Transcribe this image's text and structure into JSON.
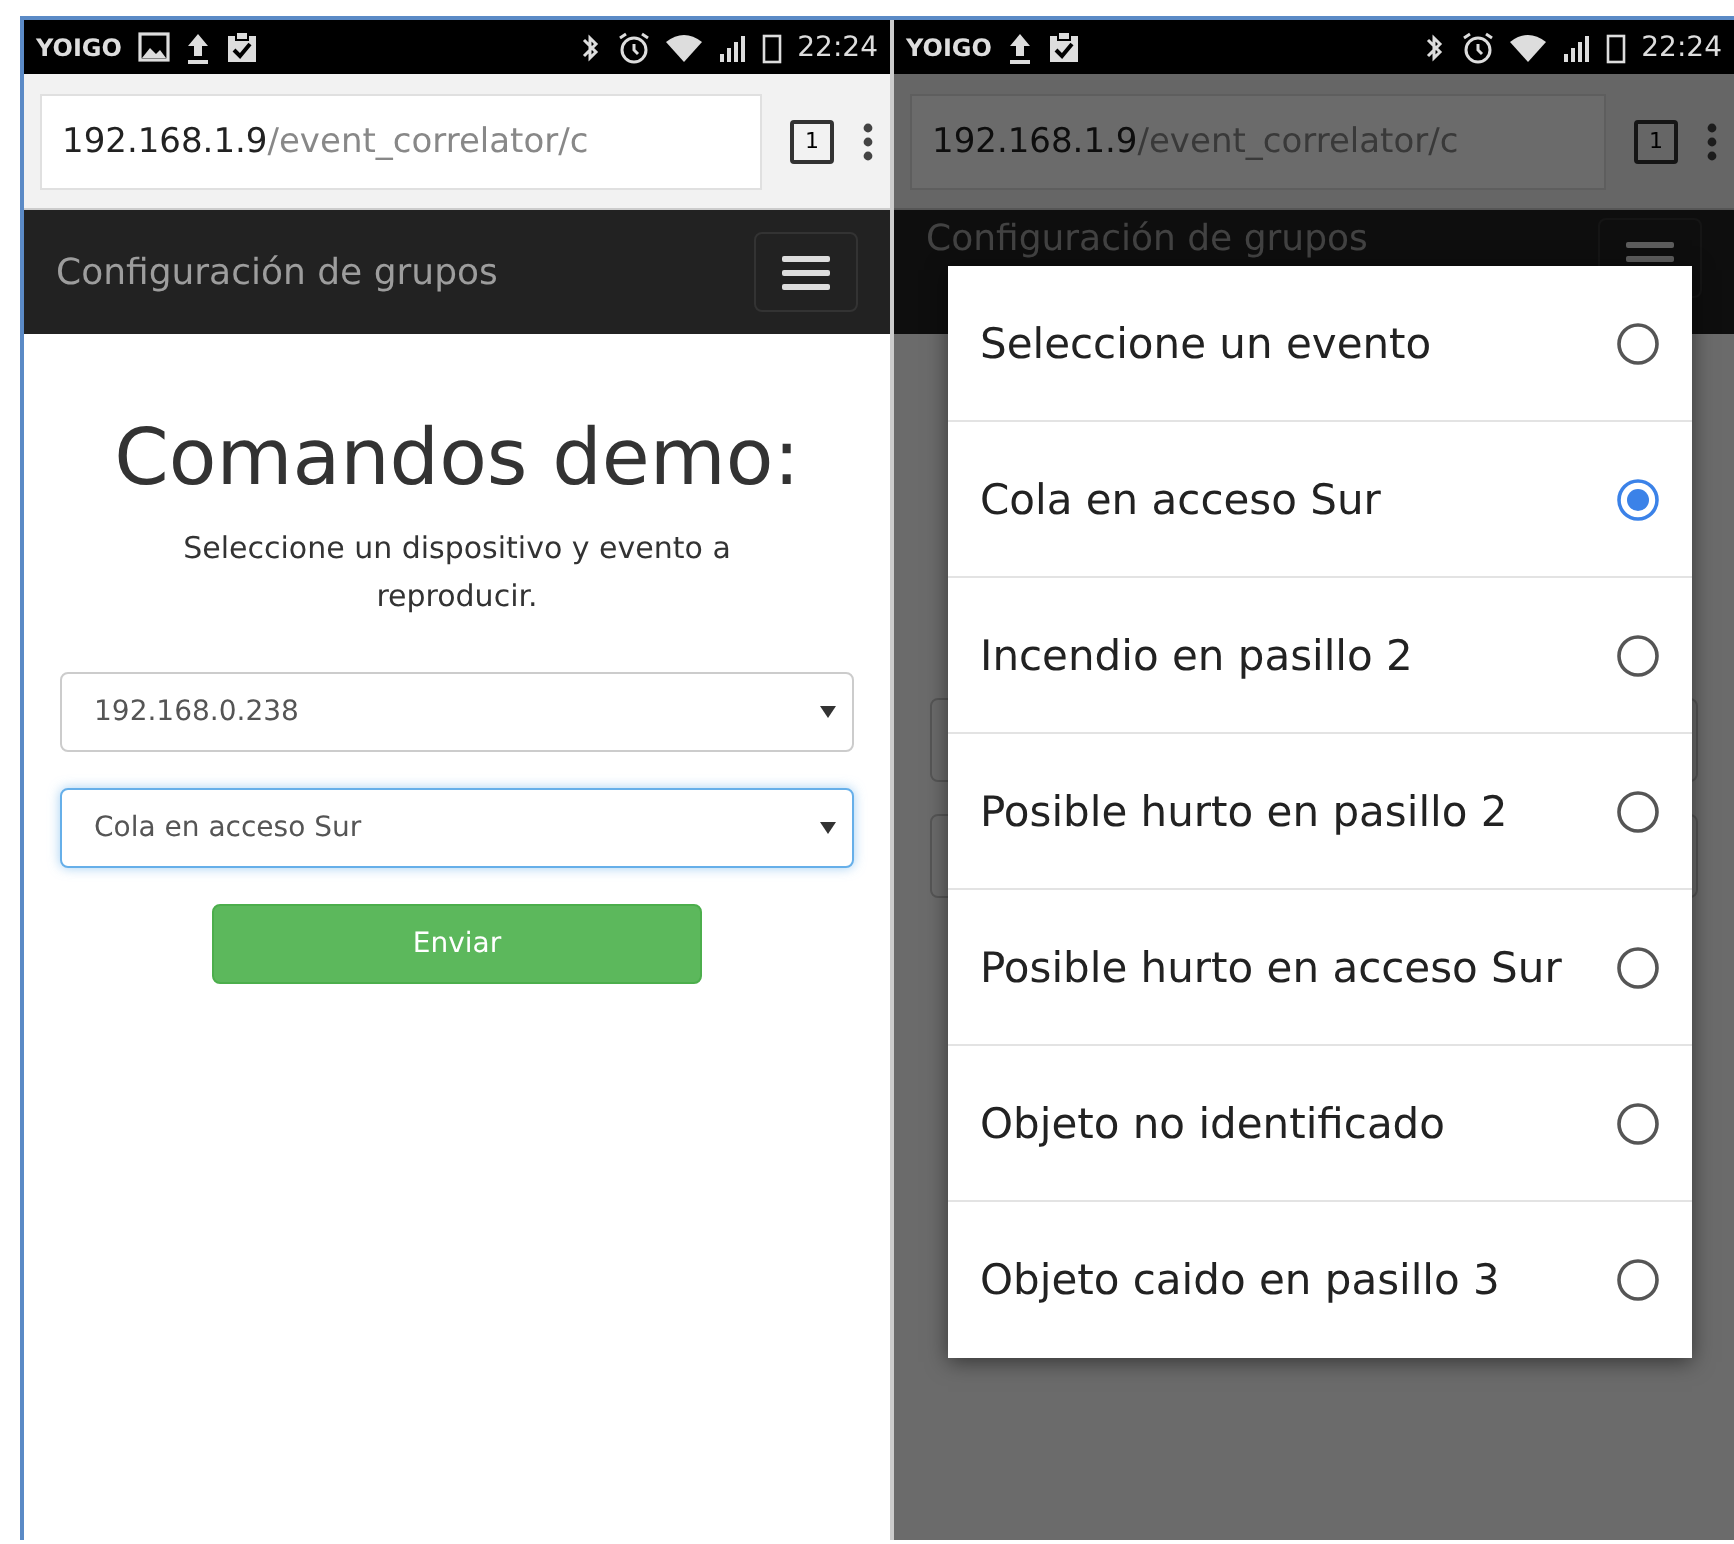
{
  "phones": [
    {
      "status_bar": {
        "carrier": "YOIGO",
        "notifications": [
          {
            "kind": "image"
          },
          {
            "kind": "upload"
          },
          {
            "kind": "clipboard"
          }
        ],
        "time": "22:24"
      },
      "address_bar": {
        "host": "192.168.1.9",
        "path": "/event_correlator/c",
        "tab_count": "1"
      },
      "navbar": {
        "title": "Configuración de grupos"
      },
      "content": {
        "heading": "Comandos demo:",
        "description": "Seleccione un dispositivo y evento a reproducir.",
        "selects": [
          {
            "value": "192.168.0.238",
            "focused": false
          },
          {
            "value": "Cola en acceso Sur",
            "focused": true
          }
        ],
        "button": "Enviar"
      }
    },
    {
      "status_bar": {
        "carrier": "YOIGO",
        "notifications": [
          {
            "kind": "upload"
          },
          {
            "kind": "clipboard"
          }
        ],
        "time": "22:24"
      },
      "address_bar": {
        "host": "192.168.1.9",
        "path": "/event_correlator/c",
        "tab_count": "1"
      },
      "navbar": {
        "title": "Configuración de grupos"
      },
      "dialog": {
        "options": [
          {
            "label": "Seleccione un evento",
            "selected": false
          },
          {
            "label": "Cola en acceso Sur",
            "selected": true
          },
          {
            "label": "Incendio en pasillo 2",
            "selected": false
          },
          {
            "label": "Posible hurto en pasillo 2",
            "selected": false
          },
          {
            "label": "Posible hurto en acceso Sur",
            "selected": false
          },
          {
            "label": "Objeto no identificado",
            "selected": false
          },
          {
            "label": "Objeto caido en pasillo 3",
            "selected": false
          }
        ]
      }
    }
  ]
}
